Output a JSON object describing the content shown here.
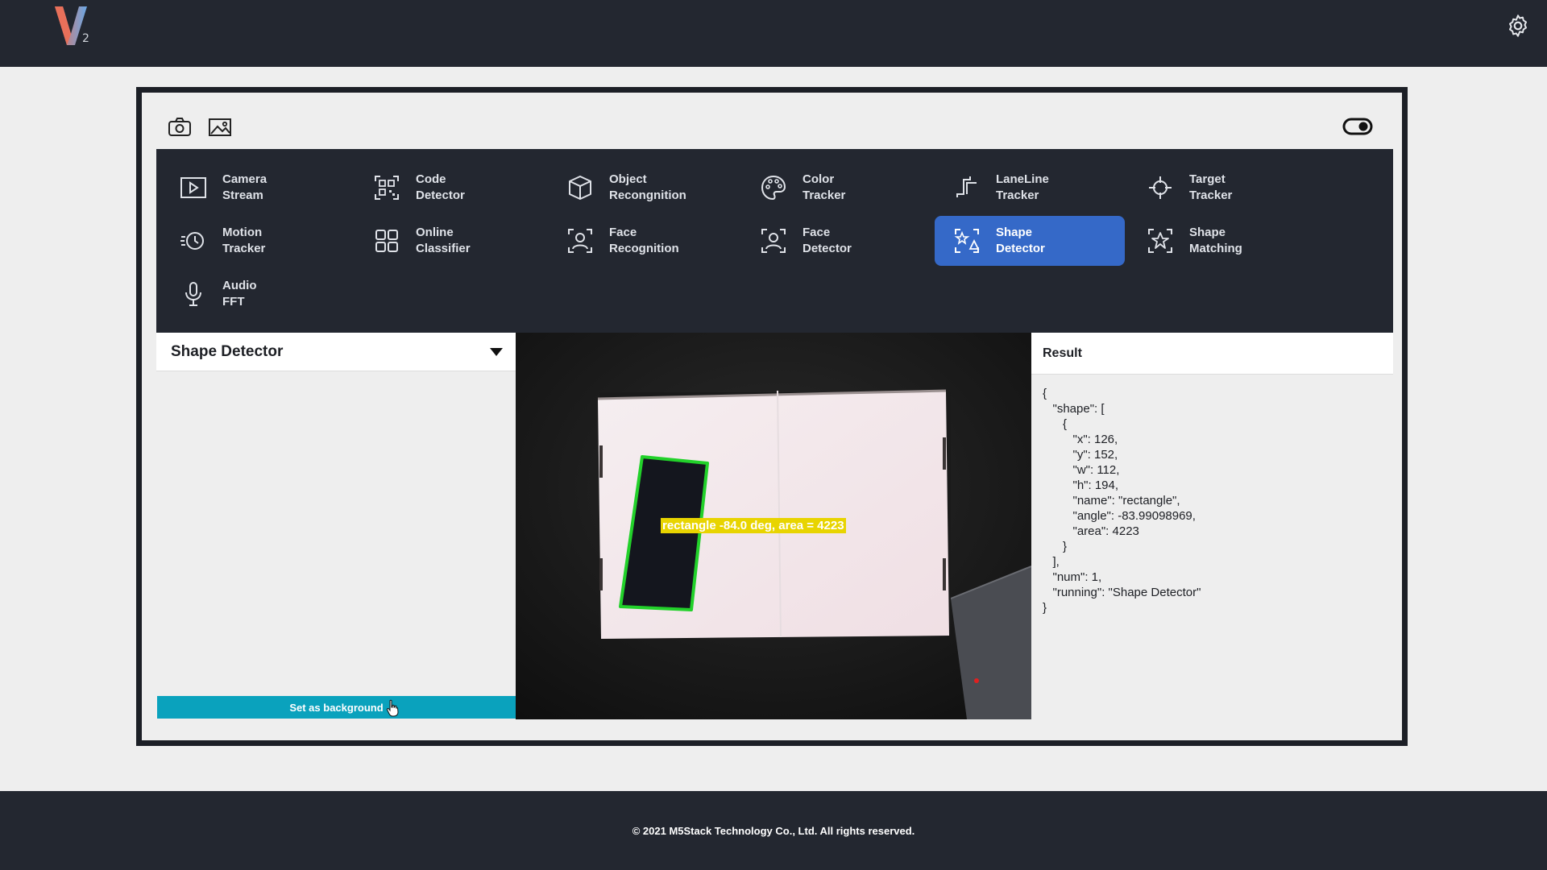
{
  "header": {
    "logo_letter": "V",
    "logo_sub": "2",
    "settings_icon": "gear-icon"
  },
  "toolbar": {
    "camera_icon": "camera-icon",
    "image_icon": "image-icon",
    "toggle_icon": "toggle-icon"
  },
  "functions": [
    {
      "label": "Camera\nStream",
      "icon": "play-icon"
    },
    {
      "label": "Code\nDetector",
      "icon": "qr-code-icon"
    },
    {
      "label": "Object\nRecongnition",
      "icon": "cube-icon"
    },
    {
      "label": "Color\nTracker",
      "icon": "palette-icon"
    },
    {
      "label": "LaneLine\nTracker",
      "icon": "lane-line-icon"
    },
    {
      "label": "Target\nTracker",
      "icon": "crosshair-icon"
    },
    {
      "label": "Motion\nTracker",
      "icon": "motion-icon"
    },
    {
      "label": "Online\nClassifier",
      "icon": "grid-icon"
    },
    {
      "label": "Face\nRecognition",
      "icon": "face-recognition-icon"
    },
    {
      "label": "Face\nDetector",
      "icon": "face-detector-icon"
    },
    {
      "label": "Shape\nDetector",
      "icon": "shapes-icon",
      "active": true
    },
    {
      "label": "Shape\nMatching",
      "icon": "star-icon"
    },
    {
      "label": "Audio\nFFT",
      "icon": "microphone-icon"
    }
  ],
  "panel": {
    "title": "Shape Detector",
    "caret_icon": "caret-down-icon",
    "button_label": "Set as background",
    "cursor_icon": "pointer-cursor-icon"
  },
  "camera": {
    "label": "rectangle -84.0 deg, area = 4223",
    "outline_color": "#22d12a",
    "label_color": "#e8d400"
  },
  "result": {
    "title": "Result",
    "json_text": "{\n   \"shape\": [\n      {\n         \"x\": 126,\n         \"y\": 152,\n         \"w\": 112,\n         \"h\": 194,\n         \"name\": \"rectangle\",\n         \"angle\": -83.99098969,\n         \"area\": 4223\n      }\n   ],\n   \"num\": 1,\n   \"running\": \"Shape Detector\"\n}"
  },
  "footer": {
    "text": "© 2021 M5Stack Technology Co., Ltd. All rights reserved."
  },
  "colors": {
    "dark": "#232730",
    "accent_active": "#3569c8",
    "button": "#0aa2bd"
  }
}
